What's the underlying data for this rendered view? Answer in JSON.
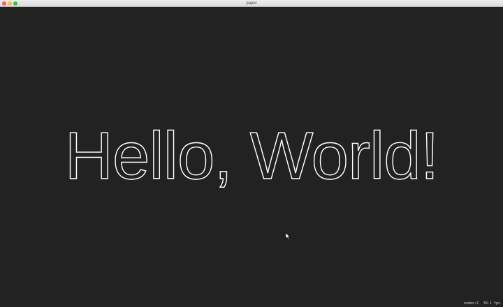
{
  "window": {
    "title": "paper"
  },
  "canvas": {
    "text": "Hello, World!",
    "stats": {
      "nodes": "nodes:2",
      "fps": "39.1 fps"
    }
  },
  "colors": {
    "background": "#222222",
    "text_stroke": "#ffffff",
    "close": "#ff5f57",
    "minimize": "#febc2e",
    "maximize": "#28c840"
  },
  "icons": [
    "close-icon",
    "minimize-icon",
    "maximize-icon",
    "mouse-cursor-icon"
  ]
}
